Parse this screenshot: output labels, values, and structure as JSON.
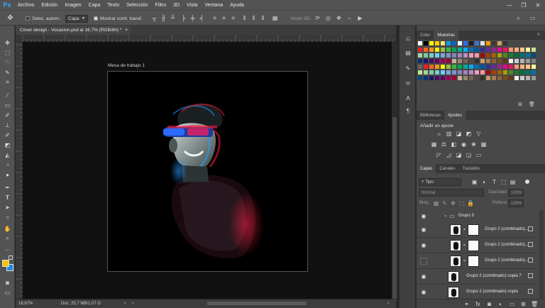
{
  "app": {
    "logo": "Ps"
  },
  "menu": [
    "Archivo",
    "Edición",
    "Imagen",
    "Capa",
    "Texto",
    "Selección",
    "Filtro",
    "3D",
    "Vista",
    "Ventana",
    "Ayuda"
  ],
  "options_bar": {
    "auto_select_label": "Selec. autom.:",
    "auto_select_value": "Capa",
    "show_transform_label": "Mostrar contr. transf.",
    "mode_3d_label": "Modo 3D:"
  },
  "document": {
    "tab_title": "Cover design - Vocacion.psd al 16,7% (RGB/8#) *",
    "close_glyph": "×",
    "artboard_name": "Mesa de trabajo 1"
  },
  "status": {
    "zoom": "16,67%",
    "doc_info": "Doc: 25,7 MB/1,07 G"
  },
  "color_panel": {
    "tabs": [
      "Color",
      "Muestras"
    ],
    "active": "Muestras"
  },
  "adjust_panel": {
    "tabs": [
      "Bibliotecas",
      "Ajustes"
    ],
    "active": "Ajustes",
    "heading": "Añadir un ajuste"
  },
  "layers_panel": {
    "tabs": [
      "Capas",
      "Canales",
      "Trazados"
    ],
    "active": "Capas",
    "filter_kind": "Tipo",
    "blend_mode": "Normal",
    "opacity_label": "Opacidad:",
    "opacity_value": "100%",
    "lock_label": "Bloq.:",
    "fill_label": "Relleno:",
    "fill_value": "100%",
    "group_name": "Grupo 3",
    "layers": [
      {
        "name": "Grupo 2 (combinado)...",
        "mask": true,
        "visible": true
      },
      {
        "name": "Grupo 2 (combinado)...",
        "mask": true,
        "visible": true
      },
      {
        "name": "Grupo 2 (combinado)...",
        "mask": true,
        "visible": false
      },
      {
        "name": "Grupo 2 (combinado) copia 7",
        "mask": false,
        "visible": true
      },
      {
        "name": "Grupo 2 (combinado) copia",
        "mask": false,
        "visible": true
      }
    ]
  },
  "colors": {
    "foreground": "#f5c400",
    "background": "#1e88e5",
    "ps_blue": "#31a8ff"
  }
}
